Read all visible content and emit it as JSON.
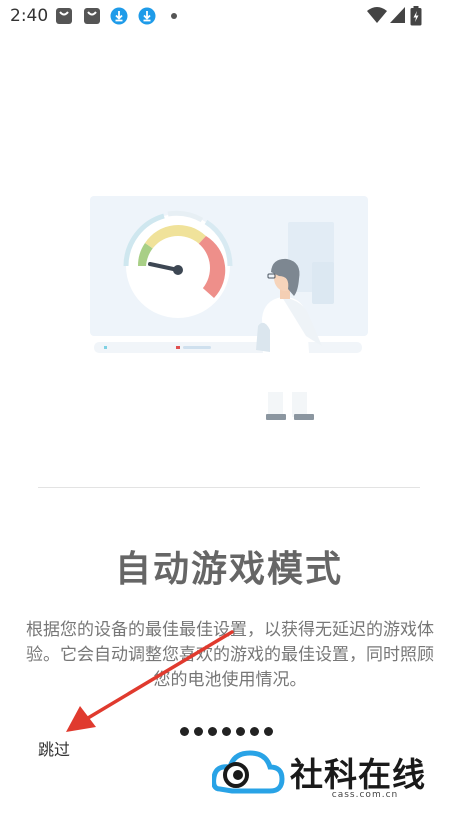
{
  "status_bar": {
    "time": "2:40",
    "notification_icons": [
      "bag-icon",
      "bag-icon",
      "download-icon",
      "download-icon",
      "dot-icon"
    ],
    "system_icons": [
      "wifi-icon",
      "signal-icon",
      "battery-icon"
    ]
  },
  "onboarding": {
    "title": "自动游戏模式",
    "description": "根据您的设备的最佳最佳设置，以获得无延迟的游戏体验。它会自动调整您喜欢的游戏的最佳设置，同时照顾您的电池使用情况。",
    "skip_label": "跳过",
    "page_count": 7,
    "current_page": 1
  },
  "watermark": {
    "brand": "社科在线",
    "domain": "cass.com.cn"
  },
  "colors": {
    "accent_red": "#e03a2e",
    "watermark_blue": "#29a3e6",
    "title_gray": "#666666"
  }
}
